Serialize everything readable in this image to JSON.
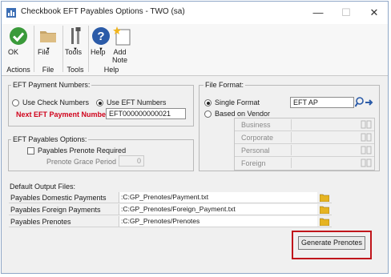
{
  "window": {
    "title": "Checkbook EFT Payables Options  -  TWO (sa)"
  },
  "ribbon": {
    "ok_label": "OK",
    "file_label": "File",
    "tools_label": "Tools",
    "help_label": "Help",
    "add_note_label_1": "Add",
    "add_note_label_2": "Note",
    "groups": {
      "actions": "Actions",
      "file": "File",
      "tools": "Tools",
      "help": "Help"
    }
  },
  "eft_payment_numbers": {
    "legend": "EFT Payment Numbers:",
    "use_check_label": "Use Check Numbers",
    "use_eft_label": "Use EFT Numbers",
    "selected": "Use EFT Numbers",
    "next_label": "Next EFT Payment Number",
    "next_value": "EFT000000000021"
  },
  "eft_payables_options": {
    "legend": "EFT Payables Options:",
    "prenote_required_label": "Payables Prenote Required",
    "prenote_required": false,
    "grace_label": "Prenote Grace Period",
    "grace_value": "0"
  },
  "file_format": {
    "legend": "File Format:",
    "single_label": "Single Format",
    "vendor_label": "Based on Vendor",
    "selected": "Single Format",
    "single_value": "EFT AP",
    "vendor_rows": [
      "Business",
      "Corporate",
      "Personal",
      "Foreign"
    ]
  },
  "output_files": {
    "heading": "Default Output Files:",
    "rows": [
      {
        "label": "Payables Domestic Payments",
        "path": ":C:GP_Prenotes/Payment.txt"
      },
      {
        "label": "Payables Foreign Payments",
        "path": ":C:GP_Prenotes/Foreign_Payment.txt"
      },
      {
        "label": "Payables Prenotes",
        "path": ":C:GP_Prenotes/Prenotes"
      }
    ]
  },
  "actions": {
    "generate_prenotes_label": "Generate Prenotes"
  },
  "colors": {
    "ok_green": "#3a9a3a",
    "help_blue": "#2b5ba8",
    "required_red": "#d0021b",
    "highlight_red": "#c0151b",
    "folder_yellow": "#e6b422"
  }
}
